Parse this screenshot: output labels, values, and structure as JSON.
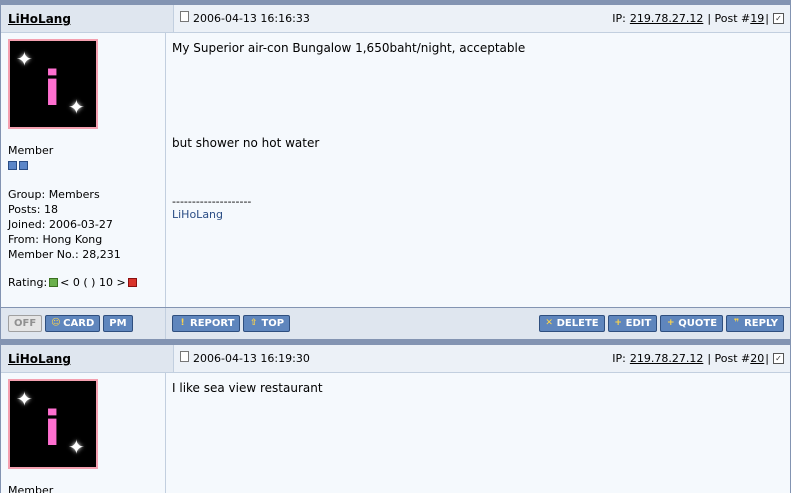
{
  "posts": [
    {
      "author": "LiHoLang",
      "date": "2006-04-13 16:16:33",
      "ip_label": "IP:",
      "ip": "219.78.27.12",
      "post_prefix": "| Post #",
      "post_num": "19",
      "post_suffix": "|",
      "group_title": "Member",
      "group": "Group: Members",
      "posts": "Posts: 18",
      "joined": "Joined: 2006-03-27",
      "from": "From: Hong Kong",
      "member_no": "Member No.: 28,231",
      "rating_label": "Rating:",
      "rating_text": "< 0 ( ) 10 >",
      "body_line1": "My Superior air-con Bungalow 1,650baht/night, acceptable",
      "body_line2": "but shower no hot water",
      "sig_divider": "--------------------",
      "sig_name": "LiHoLang"
    },
    {
      "author": "LiHoLang",
      "date": "2006-04-13 16:19:30",
      "ip_label": "IP:",
      "ip": "219.78.27.12",
      "post_prefix": "| Post #",
      "post_num": "20",
      "post_suffix": "|",
      "group_title": "Member",
      "body_line1": "I like sea view restaurant"
    }
  ],
  "actions": {
    "off": "OFF",
    "card": "CARD",
    "pm": "PM",
    "report": "REPORT",
    "top": "TOP",
    "delete": "DELETE",
    "edit": "EDIT",
    "quote": "QUOTE",
    "reply": "REPLY"
  },
  "icons": {
    "doc": "doc-icon",
    "check": "checkbox-icon"
  }
}
